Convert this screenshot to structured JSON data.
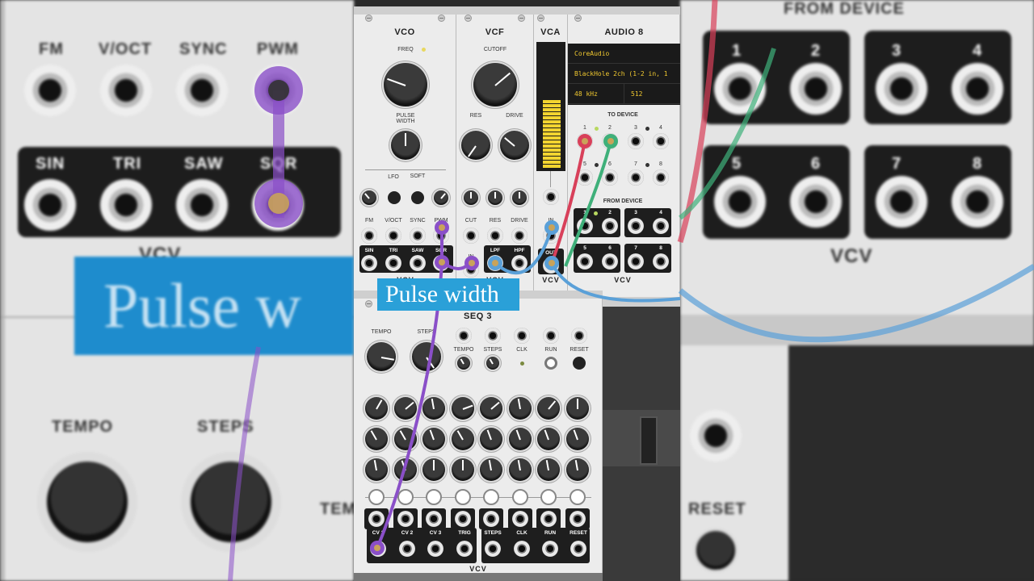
{
  "vco": {
    "title": "VCO",
    "freq_label": "FREQ",
    "pulse_width_label": "PULSE WIDTH",
    "lfo_label": "LFO",
    "soft_label": "SOFT",
    "input_labels": [
      "FM",
      "V/OCT",
      "SYNC",
      "PWM"
    ],
    "output_labels": [
      "SIN",
      "TRI",
      "SAW",
      "SQR"
    ],
    "logo": "VCV"
  },
  "vcf": {
    "title": "VCF",
    "cutoff_label": "CUTOFF",
    "res_label": "RES",
    "drive_label": "DRIVE",
    "input_labels": [
      "CUT",
      "RES",
      "DRIVE"
    ],
    "in_label": "IN",
    "output_labels": [
      "LPF",
      "HPF"
    ],
    "logo": "VCV"
  },
  "vca": {
    "title": "VCA",
    "in_label": "IN",
    "out_label": "OUT",
    "logo": "VCV",
    "level": 0.7
  },
  "audio8": {
    "title": "AUDIO 8",
    "driver": "CoreAudio",
    "device": "BlackHole 2ch (1-2 in, 1",
    "sample_rate": "48 kHz",
    "block_size": "512",
    "to_device_label": "TO DEVICE",
    "from_device_label": "FROM DEVICE",
    "channels": [
      "1",
      "2",
      "3",
      "4",
      "5",
      "6",
      "7",
      "8"
    ],
    "logo": "VCV"
  },
  "seq3": {
    "title": "SEQ 3",
    "tempo_label": "TEMPO",
    "steps_label": "STEPS",
    "small_labels": [
      "TEMPO",
      "STEPS",
      "CLK",
      "RUN",
      "RESET"
    ],
    "output_labels": [
      "CV 1",
      "CV 2",
      "CV 3",
      "TRIG"
    ],
    "output_labels2": [
      "STEPS",
      "CLK",
      "RUN",
      "RESET"
    ],
    "logo": "VCV"
  },
  "caption": "Pulse width",
  "background": {
    "caption": "Pulse w",
    "vco_input_labels": [
      "FM",
      "V/OCT",
      "SYNC",
      "PWM"
    ],
    "vco_output_labels": [
      "SIN",
      "TRI",
      "SAW",
      "SQR"
    ],
    "logo_left": "VCV",
    "seq_labels": [
      "TEMPO",
      "STEPS",
      "TEM"
    ],
    "from_device_label": "FROM DEVICE",
    "channels": [
      "1",
      "2",
      "3",
      "4",
      "5",
      "6",
      "7",
      "8"
    ],
    "logo_right": "VCV",
    "reset_label": "RESET"
  },
  "colors": {
    "purple_cable": "#8a4fc8",
    "blue_cable": "#5aa0d8",
    "red_cable": "#d8405a",
    "green_cable": "#3fb07a",
    "caption_bg": "#2aa0d8",
    "display_text": "#f0c830"
  }
}
